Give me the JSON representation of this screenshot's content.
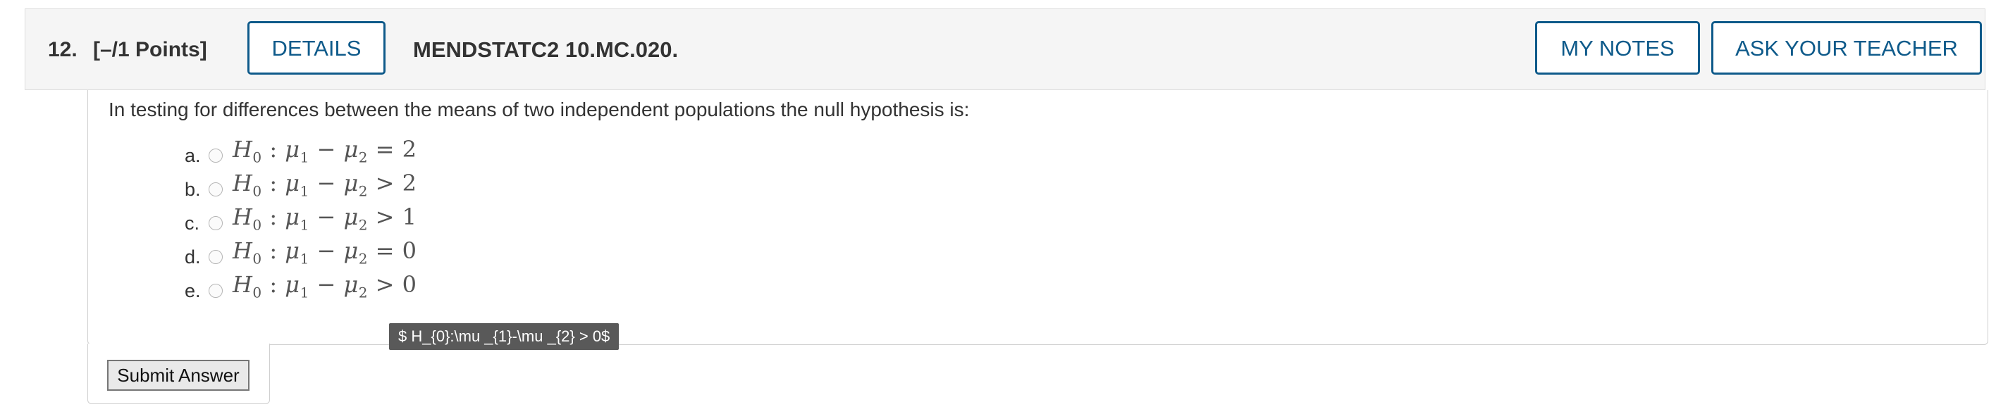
{
  "header": {
    "question_number": "12.",
    "points": "[–/1 Points]",
    "details_label": "DETAILS",
    "question_code": "MENDSTATC2 10.MC.020.",
    "my_notes_label": "MY NOTES",
    "ask_teacher_label": "ASK YOUR TEACHER"
  },
  "question": {
    "prompt": "In testing for differences between the means of two independent populations the null hypothesis is:",
    "choices": [
      {
        "letter": "a.",
        "operator": "=",
        "value": "2"
      },
      {
        "letter": "b.",
        "operator": ">",
        "value": "2"
      },
      {
        "letter": "c.",
        "operator": ">",
        "value": "1"
      },
      {
        "letter": "d.",
        "operator": "=",
        "value": "0"
      },
      {
        "letter": "e.",
        "operator": ">",
        "value": "0"
      }
    ],
    "tooltip": "$ H_{0}:\\mu _{1}-\\mu _{2} > 0$"
  },
  "actions": {
    "submit_label": "Submit Answer"
  },
  "colors": {
    "accent": "#0e5a8a",
    "header_bg": "#f5f5f5",
    "tooltip_bg": "#595959"
  }
}
